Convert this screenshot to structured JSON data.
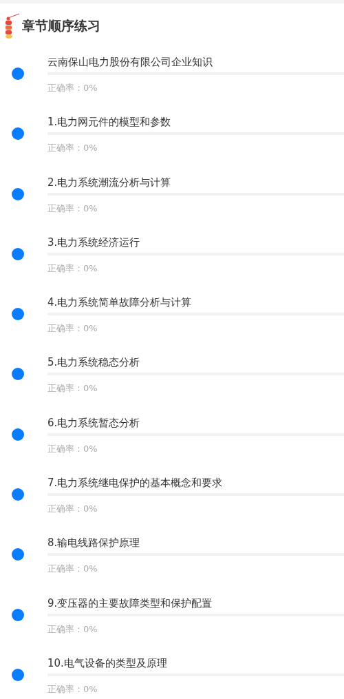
{
  "header": {
    "title": "章节顺序练习"
  },
  "chapters": [
    {
      "title": "云南保山电力股份有限公司企业知识",
      "level": 0,
      "accuracy": "正确率：0%"
    },
    {
      "title": "1.电力网元件的模型和参数",
      "level": 0,
      "accuracy": "正确率：0%"
    },
    {
      "title": "2.电力系统潮流分析与计算",
      "level": 0,
      "accuracy": "正确率：0%"
    },
    {
      "title": "3.电力系统经济运行",
      "level": 0,
      "accuracy": "正确率：0%"
    },
    {
      "title": "4.电力系统简单故障分析与计算",
      "level": 0,
      "accuracy": "正确率：0%"
    },
    {
      "title": "5.电力系统稳态分析",
      "level": 0,
      "accuracy": "正确率：0%"
    },
    {
      "title": "6.电力系统暂态分析",
      "level": 0,
      "accuracy": "正确率：0%"
    },
    {
      "title": "7.电力系统继电保护的基本概念和要求",
      "level": 0,
      "accuracy": "正确率：0%"
    },
    {
      "title": "8.输电线路保护原理",
      "level": 0,
      "accuracy": "正确率：0%"
    },
    {
      "title": "9.变压器的主要故障类型和保护配置",
      "level": 0,
      "accuracy": "正确率：0%"
    },
    {
      "title": "10.电气设备的类型及原理",
      "level": 0,
      "accuracy": "正确率：0%"
    }
  ]
}
